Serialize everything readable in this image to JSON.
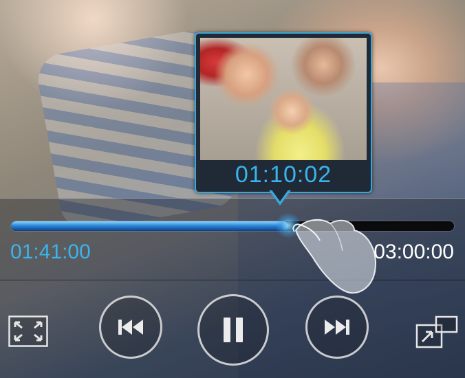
{
  "preview": {
    "time": "01:10:02"
  },
  "progress": {
    "current": "01:41:00",
    "total": "03:00:00",
    "fraction": 0.625
  },
  "controls": {
    "fullscreen_icon": "fullscreen-icon",
    "previous_icon": "skip-previous-icon",
    "pause_icon": "pause-icon",
    "next_icon": "skip-next-icon",
    "popup_icon": "popup-play-icon"
  },
  "colors": {
    "accent": "#3ab4ec",
    "progress_fill": "#2b88d8"
  }
}
